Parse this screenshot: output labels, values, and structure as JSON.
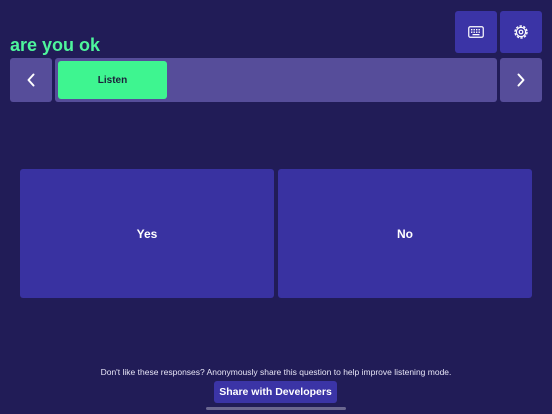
{
  "question": "are you ok",
  "toolbar": {
    "keyboard_icon": "keyboard-icon",
    "settings_icon": "settings-gear-icon"
  },
  "navigation": {
    "prev_icon": "chevron-left-icon",
    "next_icon": "chevron-right-icon",
    "active_mode": "Listen"
  },
  "responses": [
    {
      "label": "Yes"
    },
    {
      "label": "No"
    }
  ],
  "footer": {
    "feedback_text": "Don't like these responses? Anonymously share this question to help improve listening mode.",
    "share_label": "Share with Developers"
  },
  "colors": {
    "background": "#211c57",
    "accent_green": "#3ef590",
    "phrase_green": "#4ef59c",
    "button": "#3b34a6",
    "track": "#564d9a",
    "response": "#3932a1"
  }
}
